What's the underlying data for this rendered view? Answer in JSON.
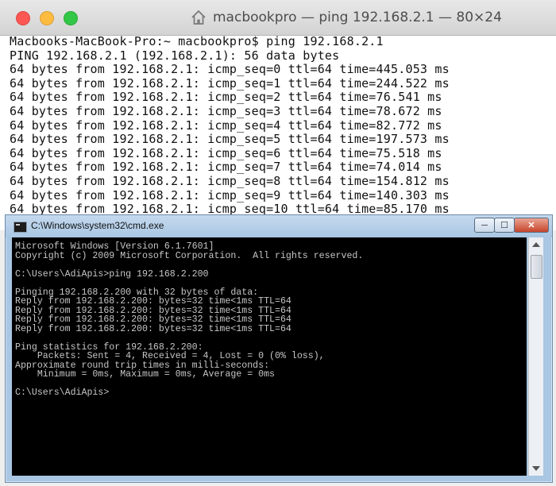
{
  "mac_terminal": {
    "title": "macbookpro — ping 192.168.2.1 — 80×24",
    "lines": [
      "Macbooks-MacBook-Pro:~ macbookpro$ ping 192.168.2.1",
      "PING 192.168.2.1 (192.168.2.1): 56 data bytes",
      "64 bytes from 192.168.2.1: icmp_seq=0 ttl=64 time=445.053 ms",
      "64 bytes from 192.168.2.1: icmp_seq=1 ttl=64 time=244.522 ms",
      "64 bytes from 192.168.2.1: icmp_seq=2 ttl=64 time=76.541 ms",
      "64 bytes from 192.168.2.1: icmp_seq=3 ttl=64 time=78.672 ms",
      "64 bytes from 192.168.2.1: icmp_seq=4 ttl=64 time=82.772 ms",
      "64 bytes from 192.168.2.1: icmp_seq=5 ttl=64 time=197.573 ms",
      "64 bytes from 192.168.2.1: icmp_seq=6 ttl=64 time=75.518 ms",
      "64 bytes from 192.168.2.1: icmp_seq=7 ttl=64 time=74.014 ms",
      "64 bytes from 192.168.2.1: icmp_seq=8 ttl=64 time=154.812 ms",
      "64 bytes from 192.168.2.1: icmp_seq=9 ttl=64 time=140.303 ms",
      "64 bytes from 192.168.2.1: icmp_seq=10 ttl=64 time=85.170 ms"
    ],
    "colors": {
      "close": "#fc5753",
      "minimize": "#fdbc40",
      "maximize": "#33c748"
    }
  },
  "cmd_window": {
    "title": "C:\\Windows\\system32\\cmd.exe",
    "buttons": {
      "minimize": "─",
      "maximize": "☐",
      "close": "✕"
    },
    "lines": [
      "Microsoft Windows [Version 6.1.7601]",
      "Copyright (c) 2009 Microsoft Corporation.  All rights reserved.",
      "",
      "C:\\Users\\AdiApis>ping 192.168.2.200",
      "",
      "Pinging 192.168.2.200 with 32 bytes of data:",
      "Reply from 192.168.2.200: bytes=32 time<1ms TTL=64",
      "Reply from 192.168.2.200: bytes=32 time<1ms TTL=64",
      "Reply from 192.168.2.200: bytes=32 time<1ms TTL=64",
      "Reply from 192.168.2.200: bytes=32 time<1ms TTL=64",
      "",
      "Ping statistics for 192.168.2.200:",
      "    Packets: Sent = 4, Received = 4, Lost = 0 (0% loss),",
      "Approximate round trip times in milli-seconds:",
      "    Minimum = 0ms, Maximum = 0ms, Average = 0ms",
      "",
      "C:\\Users\\AdiApis>"
    ]
  }
}
